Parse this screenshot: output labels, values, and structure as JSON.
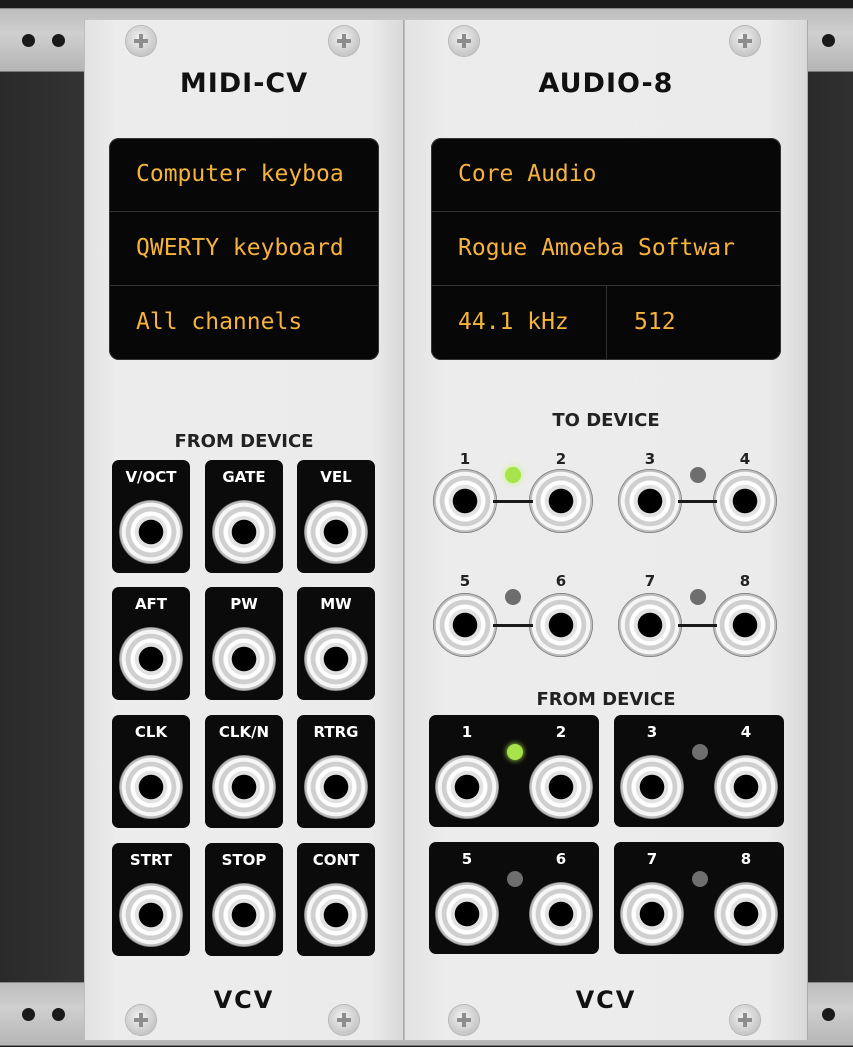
{
  "midi_cv": {
    "title": "MIDI-CV",
    "display": {
      "driver": "Computer keyboa",
      "device": "QWERTY keyboard",
      "channel": "All channels"
    },
    "section_label": "FROM DEVICE",
    "outputs": [
      "V/OCT",
      "GATE",
      "VEL",
      "AFT",
      "PW",
      "MW",
      "CLK",
      "CLK/N",
      "RTRG",
      "STRT",
      "STOP",
      "CONT"
    ],
    "logo": "VCV"
  },
  "audio_8": {
    "title": "AUDIO-8",
    "display": {
      "driver": "Core Audio",
      "device": "Rogue Amoeba Softwar",
      "sample_rate": "44.1 kHz",
      "block_size": "512"
    },
    "to_device_label": "TO DEVICE",
    "from_device_label": "FROM DEVICE",
    "channel_numbers": [
      "1",
      "2",
      "3",
      "4",
      "5",
      "6",
      "7",
      "8"
    ],
    "led_states": {
      "to_device": [
        "on",
        "off",
        "off",
        "off"
      ],
      "from_device": [
        "on",
        "off",
        "off",
        "off"
      ]
    },
    "logo": "VCV"
  },
  "colors": {
    "display_text": "#f5b33b",
    "led_on": "#a7e34a",
    "led_off": "#6e6e6e",
    "panel": "#ebebeb"
  }
}
